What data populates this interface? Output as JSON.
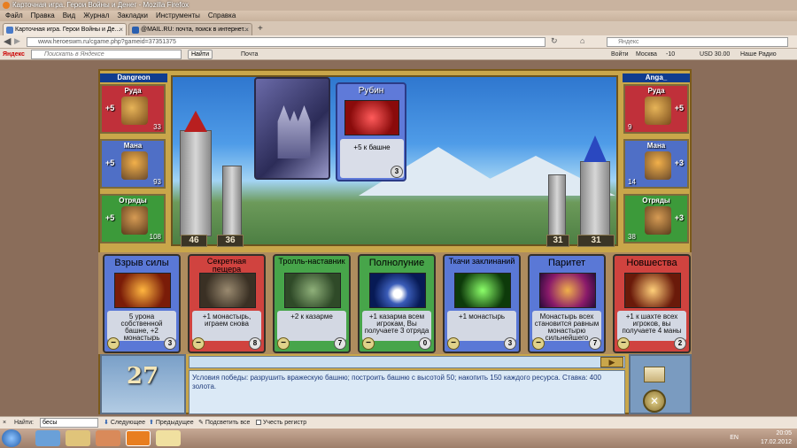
{
  "window": {
    "title": "Карточная игра. Герои Войны и Денег - Mozilla Firefox"
  },
  "menu": [
    "Файл",
    "Правка",
    "Вид",
    "Журнал",
    "Закладки",
    "Инструменты",
    "Справка"
  ],
  "tabs": [
    {
      "label": "Карточная игра. Герои Войны и Де..."
    },
    {
      "label": "@MAIL.RU: почта, поиск в интернет..."
    }
  ],
  "nav": {
    "url": "www.heroeswm.ru/cgame.php?gameid=37351375",
    "search_placeholder": "Яндекс"
  },
  "yandex_bar": {
    "logo": "Яндекс",
    "search_placeholder": "Поискать в Яндексе",
    "find_button": "Найти",
    "mail": "Почта",
    "login": "Войти",
    "city": "Москва",
    "temp": "-10",
    "usd": "USD 30.00",
    "radio": "Наше Радио"
  },
  "players": {
    "left": {
      "name": "Dangreon",
      "ore": {
        "label": "Руда",
        "inc": "+5",
        "amount": "33"
      },
      "mana": {
        "label": "Мана",
        "inc": "+5",
        "amount": "93"
      },
      "troops": {
        "label": "Отряды",
        "inc": "+5",
        "amount": "108"
      },
      "tower": "46",
      "wall": "36"
    },
    "right": {
      "name": "Anga_",
      "ore": {
        "label": "Руда",
        "inc": "+5",
        "amount": "9"
      },
      "mana": {
        "label": "Мана",
        "inc": "+3",
        "amount": "14"
      },
      "troops": {
        "label": "Отряды",
        "inc": "+3",
        "amount": "38"
      },
      "wall": "31",
      "tower": "31"
    }
  },
  "played_card": {
    "title": "Рубин",
    "desc": "+5 к башне",
    "cost": "3"
  },
  "hand": [
    {
      "title": "Взрыв силы",
      "desc": "5 урона собственной башне, +2 монастырь",
      "cost": "3",
      "color": "blue"
    },
    {
      "title": "Секретная пещера",
      "desc": "+1 монастырь, играем снова",
      "cost": "8",
      "color": "red"
    },
    {
      "title": "Тролль-наставник",
      "desc": "+2 к казарме",
      "cost": "7",
      "color": "green"
    },
    {
      "title": "Полнолуние",
      "desc": "+1 казарма всем игрокам, Вы получаете 3 отряда",
      "cost": "0",
      "color": "green"
    },
    {
      "title": "Ткачи заклинаний",
      "desc": "+1 монастырь",
      "cost": "3",
      "color": "blue"
    },
    {
      "title": "Паритет",
      "desc": "Монастырь всех становится равным монастырю сильнейшего",
      "cost": "7",
      "color": "blue"
    },
    {
      "title": "Новшества",
      "desc": "+1 к шахте всех игроков, вы получаете 4 маны",
      "cost": "2",
      "color": "red"
    }
  ],
  "turn": "27",
  "log_text": "Условия победы: разрушить вражескую башню; построить башню с высотой 50; накопить 150 каждого ресурса. Ставка: 400 золота.",
  "findbar": {
    "label": "Найти:",
    "value": "бесы",
    "next": "Следующее",
    "prev": "Предыдущее",
    "highlight": "Подсветить все",
    "match_case": "Учесть регистр"
  },
  "tray": {
    "lang": "EN",
    "time": "20:05",
    "date": "17.02.2012"
  }
}
